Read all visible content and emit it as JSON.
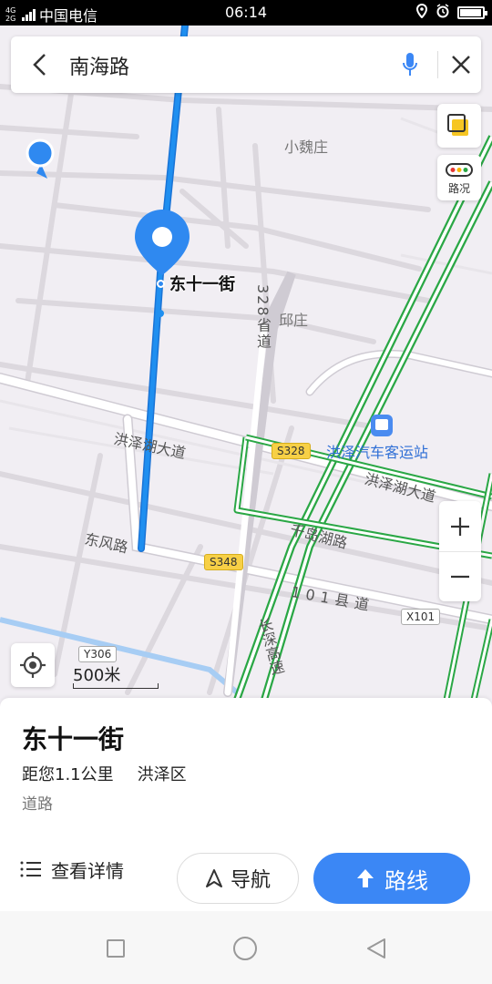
{
  "status_bar": {
    "network": "4G 2G",
    "carrier": "中国电信",
    "time": "06:14",
    "icons": [
      "location-icon",
      "alarm-icon",
      "battery-icon"
    ],
    "battery_level": 0.9
  },
  "search": {
    "query": "南海路"
  },
  "map": {
    "selected_road_label": "东十一街",
    "place_labels": [
      "小魏庄",
      "邱庄"
    ],
    "road_labels": [
      "洪泽湖大道",
      "东风路",
      "千岛湖路",
      "101县道",
      "洪泽湖大道",
      "328省道",
      "长深高速"
    ],
    "shields": [
      "S328",
      "S348",
      "X101",
      "Y306"
    ],
    "poi": "洪泽汽车客运站",
    "traffic_button_label": "路况",
    "scale_label": "500米",
    "colors": {
      "route": "#1f8ff0",
      "highway": "#2aa745",
      "water": "#a7cdf4",
      "accent": "#3b87f5"
    }
  },
  "card": {
    "title": "东十一街",
    "distance": "距您1.1公里",
    "district": "洪泽区",
    "type": "道路",
    "details_label": "查看详情",
    "nav_label": "导航",
    "route_label": "路线"
  }
}
